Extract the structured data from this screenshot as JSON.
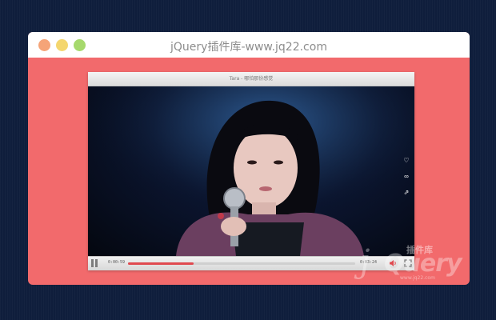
{
  "window": {
    "title": "jQuery插件库-www.jq22.com"
  },
  "player": {
    "title": "Tara - 哪怕那份感觉",
    "current_time": "0:00:59",
    "total_time": "0:03:24",
    "progress_fraction": 0.29,
    "side_buttons": [
      "heart-icon",
      "link-icon",
      "share-icon"
    ]
  },
  "watermark": {
    "letter": "j",
    "word": "Query",
    "chinese": "插件库",
    "url": "www.jq22.com"
  },
  "colors": {
    "background": "#0f1e3c",
    "window": "#f26a6c",
    "accent": "#e0494f",
    "dot_red": "#f5a478",
    "dot_yellow": "#f4d66e",
    "dot_green": "#a6d96d"
  }
}
